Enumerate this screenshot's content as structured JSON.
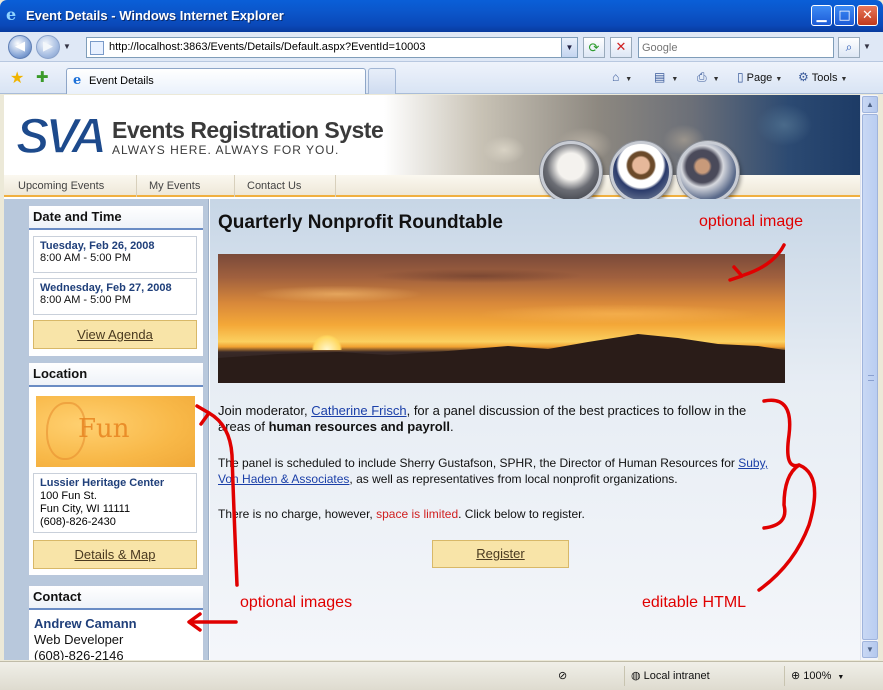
{
  "window": {
    "title": "Event Details - Windows Internet Explorer",
    "minimize_glyph": "▁",
    "maximize_glyph": "□",
    "close_glyph": "✕"
  },
  "address_bar": {
    "url": "http://localhost:3863/Events/Details/Default.aspx?EventId=10003",
    "search_placeholder": "Google"
  },
  "tab": {
    "label": "Event Details"
  },
  "commands": {
    "page_label": "Page",
    "tools_label": "Tools"
  },
  "site": {
    "logo_text": "SVA",
    "title": "Events Registration System",
    "tagline": "ALWAYS HERE. ALWAYS FOR YOU."
  },
  "nav": {
    "items": [
      "Upcoming Events",
      "My Events",
      "Contact Us"
    ]
  },
  "sidebar": {
    "date_heading": "Date and Time",
    "dates": [
      {
        "day": "Tuesday, Feb 26, 2008",
        "time": "8:00 AM - 5:00 PM"
      },
      {
        "day": "Wednesday, Feb 27, 2008",
        "time": "8:00 AM - 5:00 PM"
      }
    ],
    "agenda_button": "View Agenda",
    "location_heading": "Location",
    "location_image_text": "Fun",
    "venue": "Lussier Heritage Center",
    "street": "100 Fun St.",
    "city": "Fun City, WI 11111",
    "phone": "(608)-826-2430",
    "map_button": "Details & Map",
    "contact_heading": "Contact",
    "contact_name": "Andrew Camann",
    "contact_title": "Web Developer",
    "contact_phone": "(608)-826-2146"
  },
  "event": {
    "title": "Quarterly Nonprofit Roundtable",
    "p1_a": "Join moderator, ",
    "p1_link": "Catherine Frisch",
    "p1_b": ", for a panel discussion of the best practices to follow in the areas of ",
    "p1_bold": "human resources and payroll",
    "p1_c": ".",
    "p2_a": "The panel is scheduled to include Sherry Gustafson, SPHR, the Director of Human Resources for ",
    "p2_link": "Suby, Von Haden & Associates",
    "p2_b": ", as well as representatives from local nonprofit organizations.",
    "p3_a": "There is no charge, however, ",
    "p3_red": "space is limited",
    "p3_b": ". Click below to register.",
    "register_button": "Register"
  },
  "annotations": {
    "optional_image": "optional image",
    "optional_images": "optional images",
    "editable_html": "editable HTML",
    "color": "#e00000"
  },
  "status": {
    "zone": "Local intranet",
    "zoom": "100%"
  }
}
